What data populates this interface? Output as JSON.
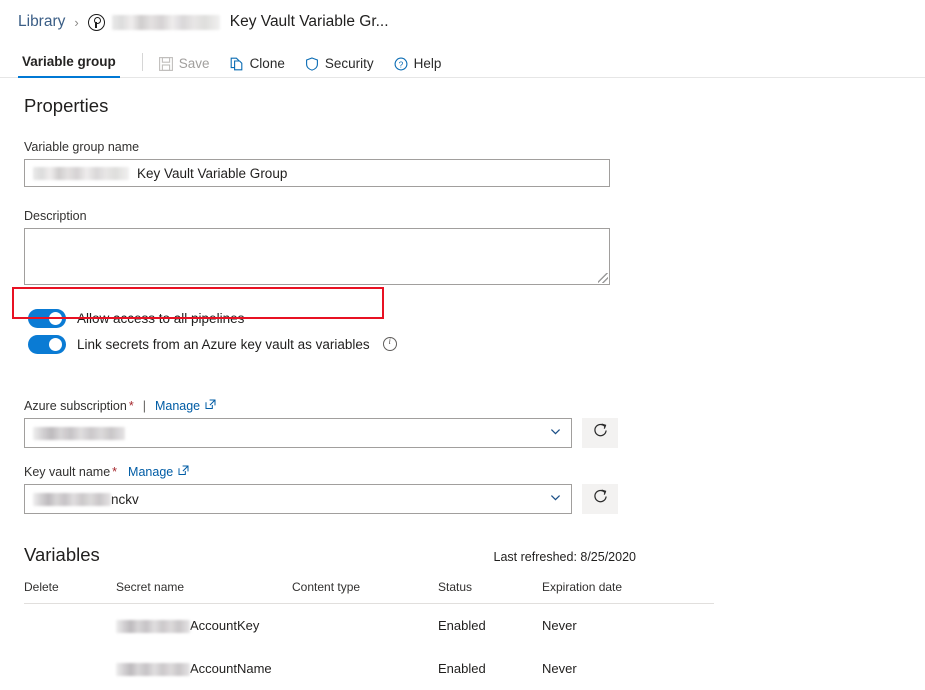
{
  "breadcrumb": {
    "root_label": "Library",
    "separator": "›",
    "project_icon": "variable-group-icon",
    "project_redacted": true,
    "title": "Key Vault Variable Gr..."
  },
  "commandbar": {
    "tab_label": "Variable group",
    "buttons": [
      {
        "label": "Save",
        "icon": "save-icon",
        "disabled": true
      },
      {
        "label": "Clone",
        "icon": "clone-icon",
        "disabled": false
      },
      {
        "label": "Security",
        "icon": "shield-icon",
        "disabled": false
      },
      {
        "label": "Help",
        "icon": "help-icon",
        "disabled": false
      }
    ]
  },
  "properties": {
    "heading": "Properties",
    "name_label": "Variable group name",
    "name_value": "Key Vault Variable Group",
    "name_redacted_prefix": true,
    "description_label": "Description",
    "description_value": "",
    "description_placeholder": ""
  },
  "toggles": [
    {
      "label": "Allow access to all pipelines",
      "on": true,
      "has_info": false
    },
    {
      "label": "Link secrets from an Azure key vault as variables",
      "on": true,
      "has_info": true
    }
  ],
  "highlight": {
    "color": "#e81123",
    "target": "link-secrets-toggle-row"
  },
  "azure": {
    "subscription": {
      "label": "Azure subscription",
      "required_marker": "*",
      "divider": "|",
      "manage_label": "Manage",
      "value": "",
      "value_redacted": true,
      "refresh_label": "refresh-icon"
    },
    "keyvault": {
      "label": "Key vault name",
      "required_marker": "*",
      "manage_label": "Manage",
      "value": "nckv",
      "value_redacted_prefix": true,
      "refresh_label": "refresh-icon"
    }
  },
  "variables": {
    "heading": "Variables",
    "last_refreshed": "Last refreshed: 8/25/2020",
    "columns": [
      "Delete",
      "Secret name",
      "Content type",
      "Status",
      "Expiration date"
    ],
    "rows": [
      {
        "delete": "",
        "secret_name": "AccountKey",
        "secret_redacted": true,
        "content_type": "",
        "status": "Enabled",
        "expiration_date": "Never"
      },
      {
        "delete": "",
        "secret_name": "AccountName",
        "secret_redacted": true,
        "content_type": "",
        "status": "Enabled",
        "expiration_date": "Never"
      }
    ]
  },
  "colors": {
    "accent": "#0078d4",
    "link": "#005ca5",
    "toggle_on": "#0a7bd4",
    "required": "#a4262c",
    "highlight": "#e81123",
    "disabled_text": "#a19f9d"
  }
}
